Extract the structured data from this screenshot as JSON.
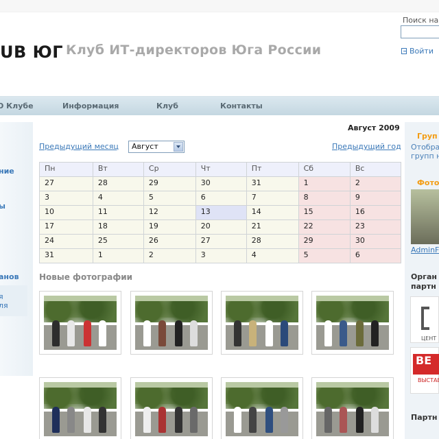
{
  "header": {
    "logo_text": "UB ЮГ",
    "slogan": "Клуб ИТ-директоров Юга России",
    "search_label": "Поиск на",
    "search_value": "",
    "login_label": "Войти"
  },
  "nav": {
    "items": [
      {
        "label": "О Клубе"
      },
      {
        "label": "Информация"
      },
      {
        "label": "Клуб"
      },
      {
        "label": "Контакты"
      }
    ]
  },
  "left_sidebar": {
    "items": [
      {
        "label": "ние"
      },
      {
        "label": "ы"
      },
      {
        "label": "анов"
      },
      {
        "label": "я"
      },
      {
        "label": "ля"
      }
    ]
  },
  "calendar": {
    "title": "Август 2009",
    "prev_month_label": "Предыдущий месяц",
    "prev_year_label": "Предыдущий год",
    "month_select_value": "Август",
    "weekdays": [
      "Пн",
      "Вт",
      "Ср",
      "Чт",
      "Пт",
      "Сб",
      "Вс"
    ],
    "weeks": [
      [
        "27",
        "28",
        "29",
        "30",
        "31",
        "1",
        "2"
      ],
      [
        "3",
        "4",
        "5",
        "6",
        "7",
        "8",
        "9"
      ],
      [
        "10",
        "11",
        "12",
        "13",
        "14",
        "15",
        "16"
      ],
      [
        "17",
        "18",
        "19",
        "20",
        "21",
        "22",
        "23"
      ],
      [
        "24",
        "25",
        "26",
        "27",
        "28",
        "29",
        "30"
      ],
      [
        "31",
        "1",
        "2",
        "3",
        "4",
        "5",
        "6"
      ]
    ],
    "today": "13"
  },
  "photos": {
    "heading": "Новые фотографии",
    "count_visible": 8
  },
  "right_sidebar": {
    "groups_title": "Груп",
    "groups_text_1": "Отобра",
    "groups_text_2": "групп н",
    "photo_title": "Фото",
    "photo_author": "AdminF",
    "org_title_1": "Орган",
    "org_title_2": "партн",
    "partner1_caption": "ЦЕНТ",
    "partner2_logo": "ВЕ",
    "partner2_caption": "ВЫСТАВ",
    "partners_title": "Партн"
  },
  "colors": {
    "link": "#3a78b8",
    "accent_orange": "#f39c12",
    "weekend_bg": "#f7e2e2",
    "weekday_bg": "#f8f8ec",
    "today_bg": "#dfe3f6",
    "nav_bg": "#c4d7e1"
  }
}
